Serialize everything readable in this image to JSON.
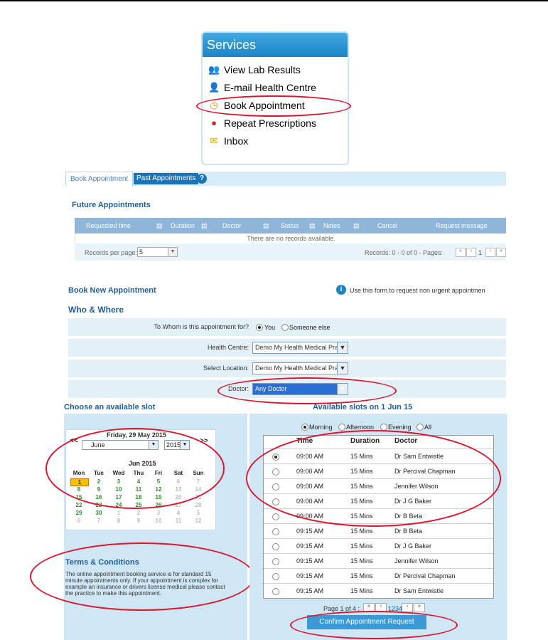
{
  "services": {
    "title": "Services",
    "items": [
      {
        "label": "View Lab Results",
        "icon": "users-icon"
      },
      {
        "label": "E-mail Health Centre",
        "icon": "person-icon"
      },
      {
        "label": "Book Appointment",
        "icon": "clock-icon"
      },
      {
        "label": "Repeat Prescriptions",
        "icon": "pill-icon"
      },
      {
        "label": "Inbox",
        "icon": "envelope-icon"
      }
    ]
  },
  "tabs": {
    "book": "Book Appointment",
    "past": "Past Appointments"
  },
  "future": {
    "title": "Future Appointments",
    "columns": [
      "Requested time",
      "Duration",
      "Doctor",
      "Status",
      "Notes",
      "Cancel",
      "Request message"
    ],
    "empty": "There are no records available.",
    "records_per_page_label": "Records per page:",
    "records_per_page": "5",
    "records_info": "Records: 0 - 0 of 0 - Pages:",
    "page": "1"
  },
  "book_new": {
    "title": "Book New Appointment",
    "info": "Use this form to request non urgent appointmen"
  },
  "who_where": {
    "title": "Who & Where",
    "whom_label": "To Whom is this appointment for?",
    "whom_you": "You",
    "whom_else": "Someone else",
    "centre_label": "Health Centre:",
    "centre_value": "Demo My Health Medical Prac",
    "location_label": "Select Location:",
    "location_value": "Demo My Health Medical Prac",
    "doctor_label": "Doctor:",
    "doctor_value": "Any Doctor"
  },
  "slot_section": {
    "choose": "Choose an available slot",
    "available": "Available slots on 1 Jun 15"
  },
  "calendar": {
    "date_title": "Friday, 29 May 2015",
    "prev": "<<",
    "next": ">>",
    "month": "June",
    "year": "2015",
    "month_title": "Jun 2015",
    "weekdays": [
      "Mon",
      "Tue",
      "Wed",
      "Thu",
      "Fri",
      "Sat",
      "Sun"
    ],
    "weeks": [
      [
        "1",
        "2",
        "3",
        "4",
        "5",
        "6",
        "7"
      ],
      [
        "8",
        "9",
        "10",
        "11",
        "12",
        "13",
        "14"
      ],
      [
        "15",
        "16",
        "17",
        "18",
        "19",
        "20",
        "21"
      ],
      [
        "22",
        "23",
        "24",
        "25",
        "26",
        "27",
        "28"
      ],
      [
        "29",
        "30",
        "1",
        "2",
        "3",
        "4",
        "5"
      ],
      [
        "6",
        "7",
        "8",
        "9",
        "10",
        "11",
        "12"
      ]
    ]
  },
  "terms": {
    "title": "Terms & Conditions",
    "text": "The online appointment booking service is for standard 15 minute appointments only. If your appointment is complex for example an insurance or drivers license medical please contact the practice to make this appointment."
  },
  "filters": [
    "Morning",
    "Afternoon",
    "Evening",
    "All"
  ],
  "slots": {
    "headers": [
      "Time",
      "Duration",
      "Doctor"
    ],
    "rows": [
      {
        "time": "09:00 AM",
        "duration": "15 Mins",
        "doctor": "Dr Sam Entwistle",
        "selected": true
      },
      {
        "time": "09:00 AM",
        "duration": "15 Mins",
        "doctor": "Dr Percival Chapman"
      },
      {
        "time": "09:00 AM",
        "duration": "15 Mins",
        "doctor": "Jennifer Wilson"
      },
      {
        "time": "09:00 AM",
        "duration": "15 Mins",
        "doctor": "Dr J G Baker"
      },
      {
        "time": "09:00 AM",
        "duration": "15 Mins",
        "doctor": "Dr B Beta"
      },
      {
        "time": "09:15 AM",
        "duration": "15 Mins",
        "doctor": "Dr B Beta"
      },
      {
        "time": "09:15 AM",
        "duration": "15 Mins",
        "doctor": "Dr J G Baker"
      },
      {
        "time": "09:15 AM",
        "duration": "15 Mins",
        "doctor": "Jennifer Wilson"
      },
      {
        "time": "09:15 AM",
        "duration": "15 Mins",
        "doctor": "Dr Percival Chapman"
      },
      {
        "time": "09:15 AM",
        "duration": "15 Mins",
        "doctor": "Dr Sam Entwistle"
      }
    ],
    "page_info": "Page 1 of 4 :",
    "pages": "1234",
    "confirm": "Confirm Appointment Request"
  },
  "colors": {
    "accent": "#1b84c8",
    "panel": "#cfe6f4",
    "highlight": "#e0132b",
    "today": "#f2c200",
    "green_day": "#2e8b2e"
  }
}
